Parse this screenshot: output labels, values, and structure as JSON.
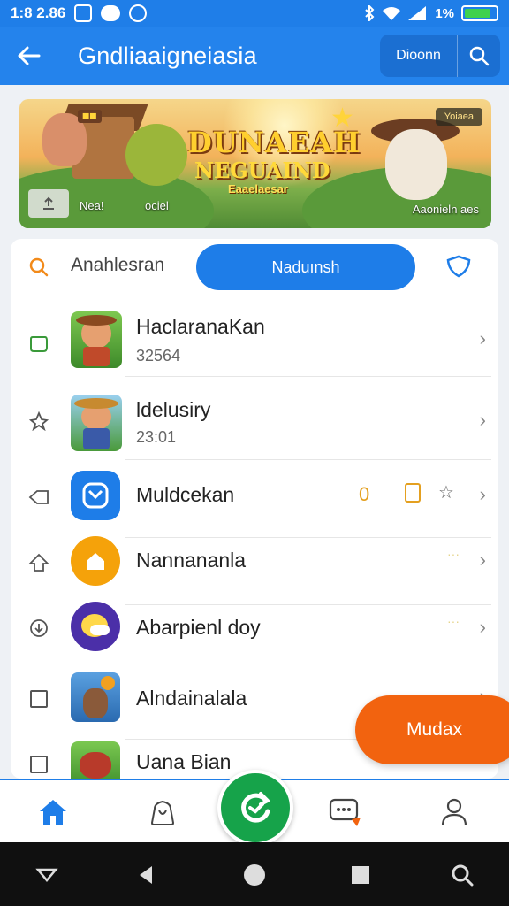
{
  "status_bar": {
    "time": "1:8 2.86",
    "battery_percent": "1%",
    "battery_level": 0.85
  },
  "app_bar": {
    "title": "Gndliaaigneiasia",
    "action_label": "Dioonn",
    "back_icon": "arrow-left-icon",
    "search_icon": "search-icon"
  },
  "banner": {
    "logo_line1": "DUNAEAH",
    "logo_line2": "NEGUAIND",
    "logo_line3": "Eaaelaesar",
    "badge_top_right": "Yoiaea",
    "caption_left_1": "Nea!",
    "caption_left_2": "ociel",
    "caption_right": "Aaonieln aes"
  },
  "filter": {
    "search_label": "Anahlesran",
    "pill_label": "Naduınsh"
  },
  "items": [
    {
      "title": "HaclaranaKan",
      "subtitle": "32564",
      "left_icon": "tag-icon"
    },
    {
      "title": "ldelusiry",
      "subtitle": "23:01",
      "left_icon": "leaf-icon"
    },
    {
      "title": "Muldcekan",
      "subtitle": "",
      "left_icon": "bookmark-icon",
      "extra_count": "0"
    },
    {
      "title": "Nannananla",
      "subtitle": "",
      "left_icon": "arrow-icon"
    },
    {
      "title": "Abarpienl doy",
      "subtitle": "",
      "left_icon": "download-icon"
    },
    {
      "title": "Alndainalala",
      "subtitle": "",
      "left_icon": "checkbox-icon"
    },
    {
      "title": "Uana Bian",
      "subtitle": "",
      "left_icon": "checkbox-icon"
    }
  ],
  "floating_button": {
    "label": "Mudax"
  },
  "bottom_nav": [
    "home-icon",
    "bag-icon",
    "refresh-icon",
    "chat-icon",
    "profile-icon"
  ],
  "colors": {
    "primary": "#2483ec",
    "accent_green": "#16a34a",
    "accent_orange": "#f2630f"
  }
}
